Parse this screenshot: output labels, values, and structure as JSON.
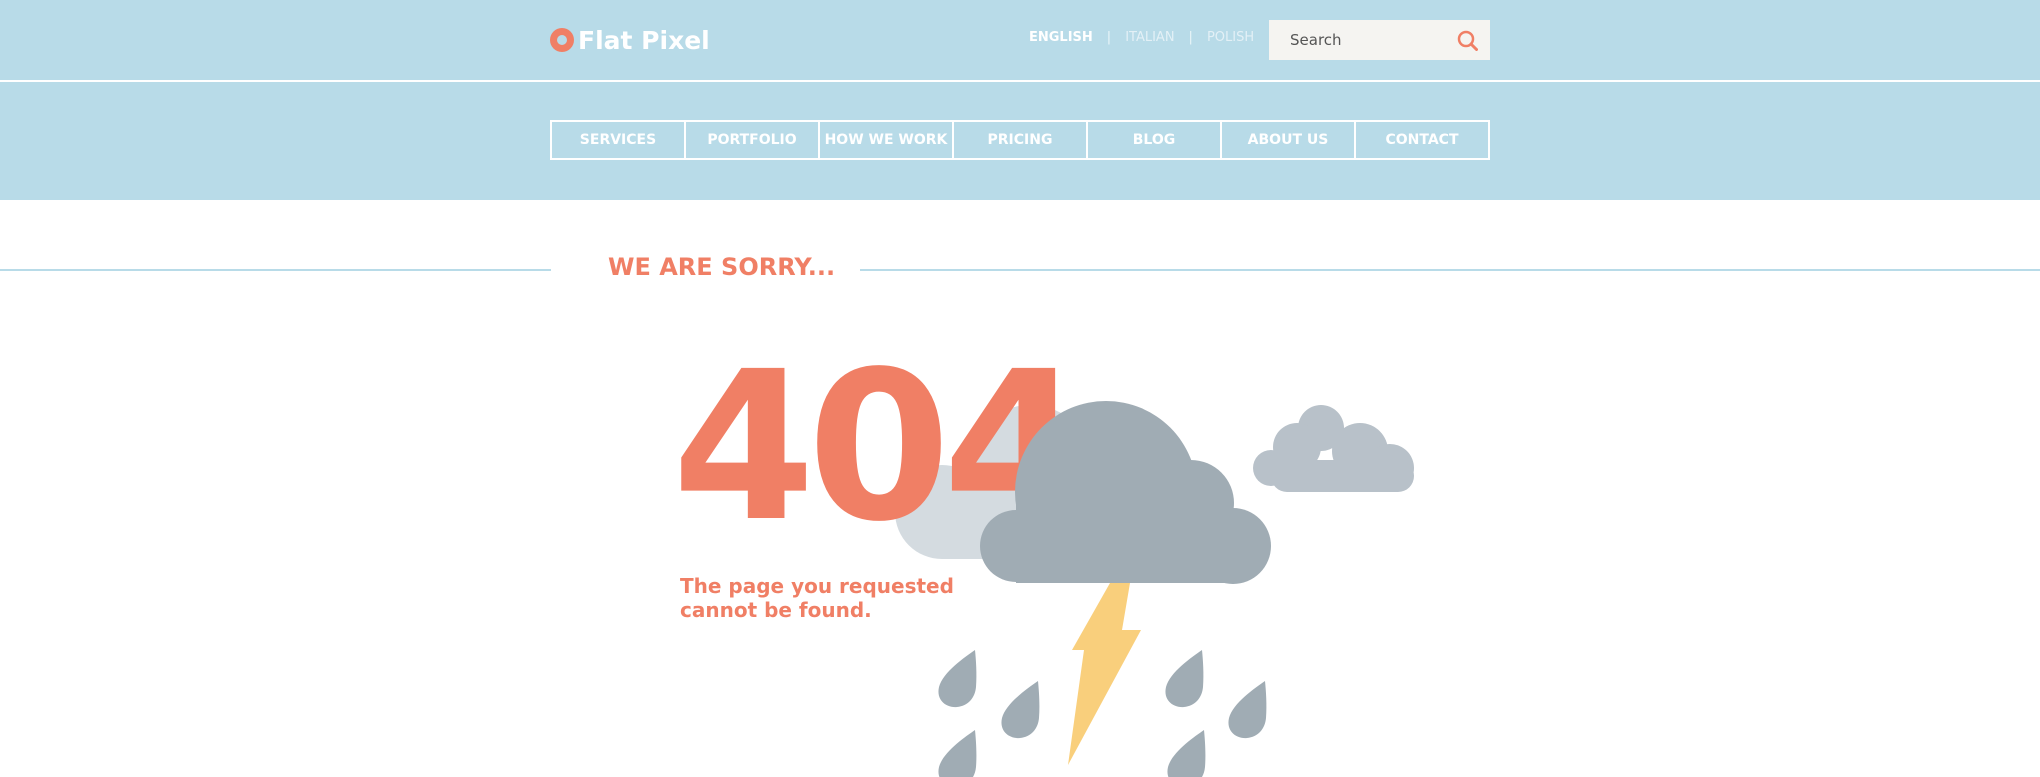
{
  "brand": {
    "name": "Flat Pixel",
    "logo_icon": "pin-circle-icon"
  },
  "languages": [
    {
      "label": "ENGLISH",
      "active": true
    },
    {
      "label": "ITALIAN",
      "active": false
    },
    {
      "label": "POLISH",
      "active": false
    }
  ],
  "language_separator": "|",
  "search": {
    "placeholder": "Search",
    "icon": "search-icon"
  },
  "nav": {
    "items": [
      "SERVICES",
      "PORTFOLIO",
      "HOW WE WORK",
      "PRICING",
      "BLOG",
      "ABOUT US",
      "CONTACT"
    ]
  },
  "error": {
    "heading": "WE ARE SORRY...",
    "code": "404",
    "message": "The page you requested cannot be found."
  },
  "colors": {
    "header_bg": "#b8dbe8",
    "accent": "#f07f65",
    "cloud_dark": "#a0acb4",
    "cloud_light": "#d4dbe0",
    "lightning": "#f9cf7c"
  }
}
